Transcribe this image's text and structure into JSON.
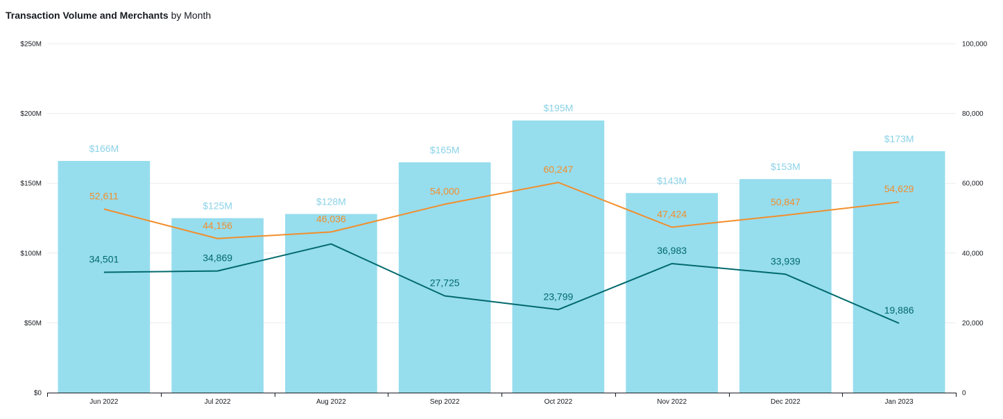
{
  "title_bold": "Transaction Volume and Merchants",
  "title_rest": " by Month",
  "chart_data": {
    "type": "bar",
    "title": "Transaction Volume and Merchants by Month",
    "categories": [
      "Jun 2022",
      "Jul 2022",
      "Aug 2022",
      "Sep 2022",
      "Oct 2022",
      "Nov 2022",
      "Dec 2022",
      "Jan 2023"
    ],
    "bars": {
      "values": [
        166,
        125,
        128,
        165,
        195,
        143,
        153,
        173
      ],
      "labels": [
        "$166M",
        "$125M",
        "$128M",
        "$165M",
        "$195M",
        "$143M",
        "$153M",
        "$173M"
      ],
      "color": "#96ddee",
      "label_color": "#8ad2e7"
    },
    "lines": [
      {
        "values": [
          52611,
          44156,
          46036,
          54000,
          60247,
          47424,
          50847,
          54629
        ],
        "labels": [
          "52,611",
          "44,156",
          "46,036",
          "54,000",
          "60,247",
          "47,424",
          "50,847",
          "54,629"
        ],
        "color": "#f28e2b"
      },
      {
        "values": [
          34501,
          34869,
          42600,
          27725,
          23799,
          36983,
          33939,
          19886
        ],
        "labels": [
          "34,501",
          "34,869",
          "",
          "27,725",
          "23,799",
          "36,983",
          "33,939",
          "19,886"
        ],
        "color": "#00696d"
      }
    ],
    "left_axis": {
      "ylim": [
        0,
        250
      ],
      "ticks": [
        0,
        50,
        100,
        150,
        200,
        250
      ],
      "tick_labels": [
        "$0",
        "$50M",
        "$100M",
        "$150M",
        "$200M",
        "$250M"
      ]
    },
    "right_axis": {
      "ylim": [
        0,
        100000
      ],
      "ticks": [
        0,
        20000,
        40000,
        60000,
        80000,
        100000
      ],
      "tick_labels": [
        "0",
        "20,000",
        "40,000",
        "60,000",
        "80,000",
        "100,000"
      ]
    },
    "grid": true,
    "grid_color": "#e9ebed",
    "axis_color": "#16191f"
  }
}
